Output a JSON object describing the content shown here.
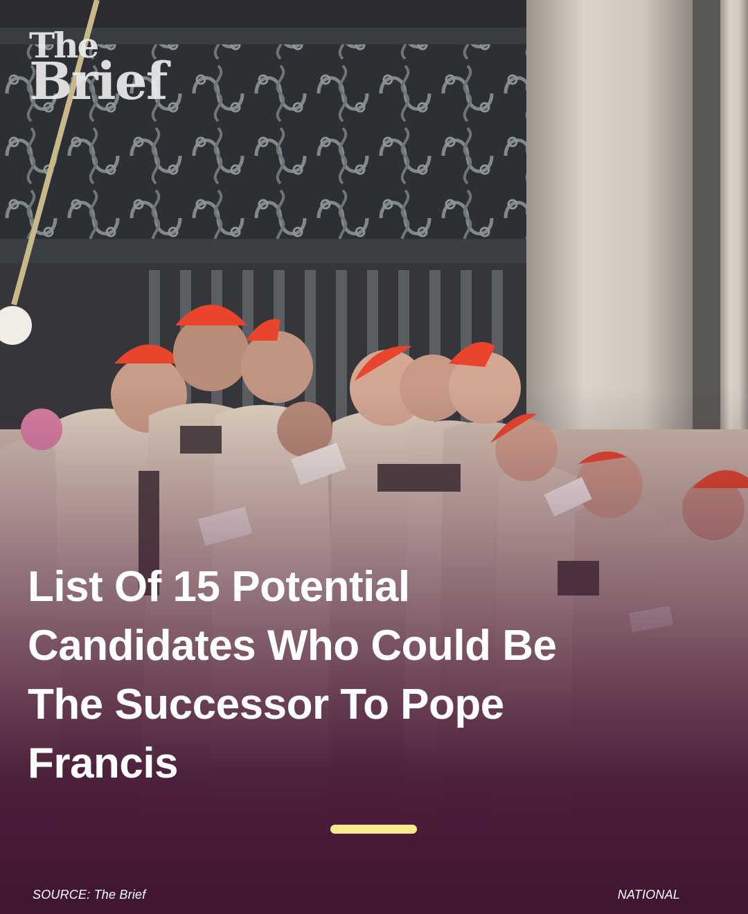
{
  "brand": {
    "logo_line1": "The",
    "logo_line2": "Brief"
  },
  "headline": {
    "text": "List Of 15 Potential Candidates Who Could Be The Successor To Pope Francis"
  },
  "footer": {
    "source": "SOURCE: The Brief",
    "category": "NATIONAL"
  },
  "colors": {
    "background": "#3d1530",
    "accent": "#f7e98e",
    "text": "#ffffff",
    "cardinal_cap": "#e8452c"
  }
}
